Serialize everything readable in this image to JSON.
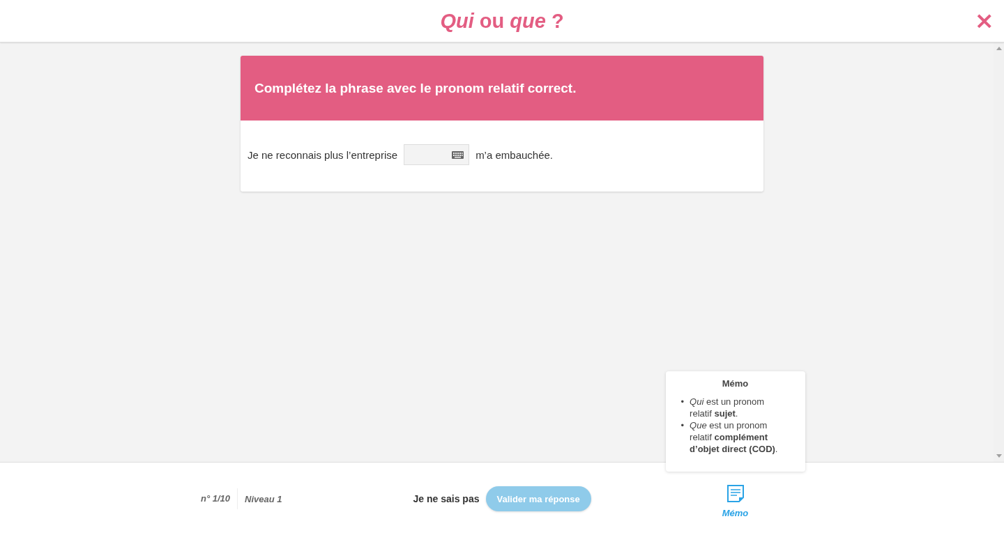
{
  "header": {
    "title": "*Qui* ou *que* ?",
    "close": "×"
  },
  "exercise": {
    "instruction": "Complétez la phrase avec le pronom relatif correct.",
    "before": "Je ne reconnais plus l’entreprise",
    "after": "m’a embauchée."
  },
  "memo": {
    "open": true,
    "title": "Mémo",
    "items": [
      {
        "marker": "•",
        "text": "*Qui* est un pronom relatif **sujet**."
      },
      {
        "marker": "•",
        "text": "*Que* est un pronom relatif **complément d’objet direct (COD)**."
      }
    ],
    "button_label": "Mémo"
  },
  "footer": {
    "question_number": "n° 1/10",
    "level": "Niveau 1",
    "skip": "Je ne sais pas",
    "submit": {
      "label": "Valider ma réponse",
      "disabled": true
    }
  }
}
